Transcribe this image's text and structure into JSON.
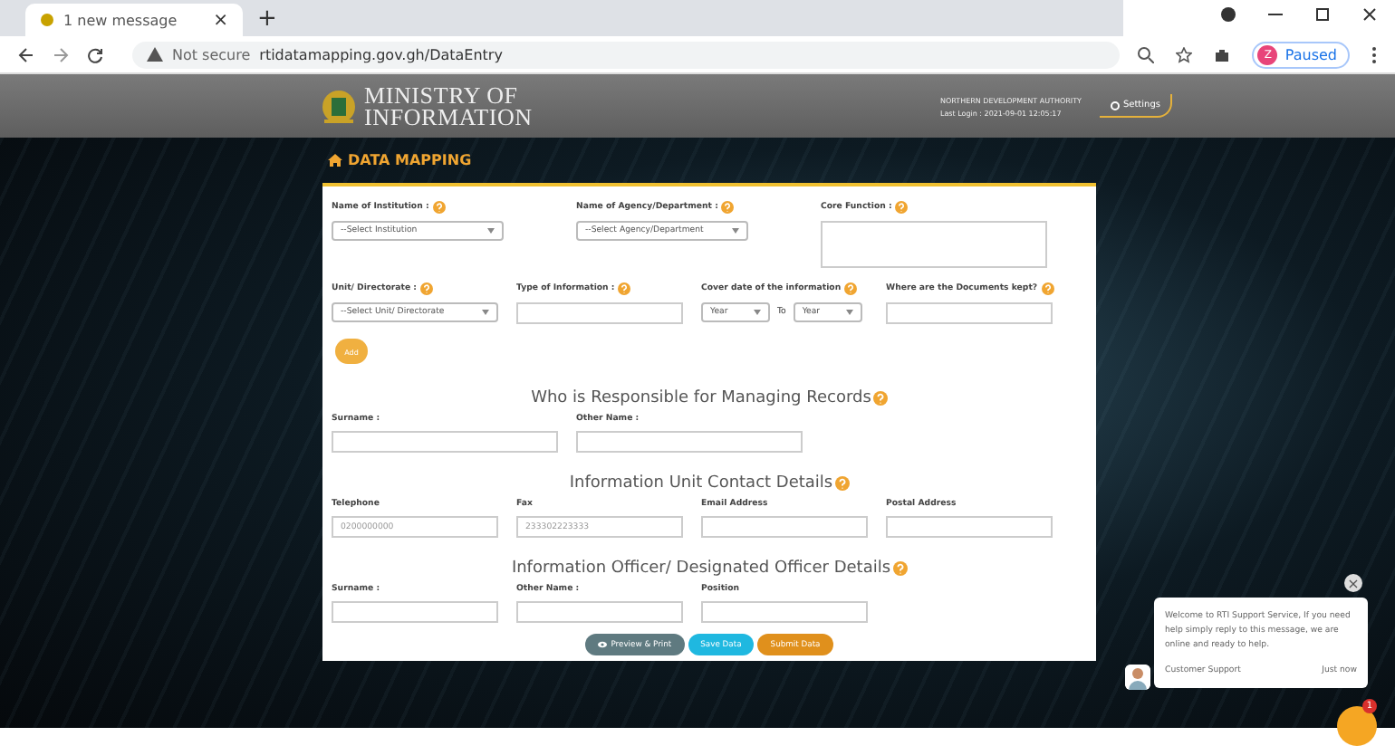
{
  "browser": {
    "tab_title": "1 new message",
    "tab_close": "×",
    "new_tab": "+",
    "security": "Not secure",
    "url": "rtidatamapping.gov.gh/DataEntry",
    "profile_initial": "Z",
    "profile_status": "Paused"
  },
  "header": {
    "logo_text": "MINISTRY OF INFORMATION",
    "organization": "NORTHERN DEVELOPMENT AUTHORITY",
    "last_login": "Last Login : 2021-09-01 12:05:17",
    "settings": "Settings"
  },
  "page_title": "DATA MAPPING",
  "form": [
    {
      "kind": "fields",
      "fields": [
        {
          "kind": "select",
          "label": "Name of Institution :",
          "help": true,
          "placeholder": "--Select Institution"
        },
        {
          "kind": "select",
          "label": "Name of Agency/Department :",
          "help": true,
          "placeholder": "--Select Agency/Department"
        },
        {
          "kind": "textarea",
          "label": "Core Function :",
          "help": true
        }
      ]
    },
    {
      "kind": "fields",
      "fields": [
        {
          "kind": "select",
          "label": "Unit/ Directorate :",
          "help": true,
          "placeholder": "--Select Unit/ Directorate"
        },
        {
          "kind": "input",
          "label": "Type of Information :",
          "help": true
        },
        {
          "kind": "year_range",
          "label": "Cover date of the information",
          "help": true,
          "from": "Year",
          "to_label": "To",
          "to": "Year"
        },
        {
          "kind": "input",
          "label": "Where are the Documents kept?",
          "help": true
        }
      ]
    },
    {
      "kind": "button",
      "label": "Add"
    },
    {
      "kind": "heading",
      "text": "Who is Responsible for Managing Records",
      "help": true
    },
    {
      "kind": "fields",
      "fields": [
        {
          "kind": "input",
          "label": "Surname :",
          "help": false
        },
        {
          "kind": "input",
          "label": "Other Name :",
          "help": false
        }
      ]
    },
    {
      "kind": "heading",
      "text": "Information Unit Contact Details",
      "help": true
    },
    {
      "kind": "fields",
      "fields": [
        {
          "kind": "input",
          "label": "Telephone",
          "help": false,
          "placeholder": "0200000000"
        },
        {
          "kind": "input",
          "label": "Fax",
          "help": false,
          "placeholder": "233302223333"
        },
        {
          "kind": "input",
          "label": "Email Address",
          "help": false
        },
        {
          "kind": "input",
          "label": "Postal Address",
          "help": false
        }
      ]
    },
    {
      "kind": "heading",
      "text": "Information Officer/ Designated Officer Details",
      "help": true
    },
    {
      "kind": "fields",
      "fields": [
        {
          "kind": "input",
          "label": "Surname :",
          "help": false
        },
        {
          "kind": "input",
          "label": "Other Name :",
          "help": false
        },
        {
          "kind": "input",
          "label": "Position",
          "help": false
        }
      ]
    },
    {
      "kind": "actions",
      "buttons": [
        {
          "kind": "preview",
          "label": "Preview & Print"
        },
        {
          "kind": "save",
          "label": "Save Data"
        },
        {
          "kind": "submit",
          "label": "Submit Data"
        }
      ]
    }
  ],
  "chat": {
    "message": "Welcome to RTI Support Service, If you need help simply reply to this message, we are online and ready to help.",
    "agent": "Customer Support",
    "time": "Just now",
    "close": "×",
    "badge": "1"
  }
}
